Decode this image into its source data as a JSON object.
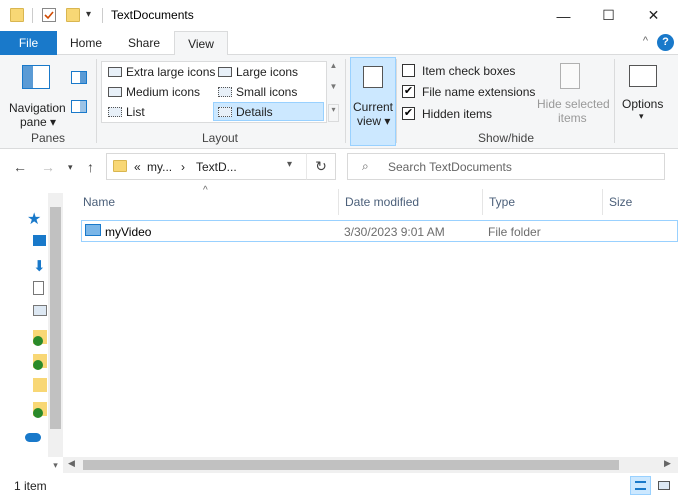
{
  "window": {
    "title": "TextDocuments",
    "minimize": "—",
    "maximize": "☐",
    "close": "✕"
  },
  "ribbon": {
    "tabs": [
      "File",
      "Home",
      "Share",
      "View"
    ],
    "active_tab": "View",
    "collapse": "^",
    "help": "?",
    "panes": {
      "label": "Panes",
      "navigation_pane_line1": "Navigation",
      "navigation_pane_line2": "pane"
    },
    "layout": {
      "label": "Layout",
      "items": [
        "Extra large icons",
        "Large icons",
        "Medium icons",
        "Small icons",
        "List",
        "Details"
      ],
      "selected": "Details"
    },
    "current_view": {
      "line1": "Current",
      "line2": "view"
    },
    "show_hide": {
      "label": "Show/hide",
      "item_check_boxes": "Item check boxes",
      "file_name_extensions": "File name extensions",
      "hidden_items": "Hidden items",
      "item_check_boxes_checked": false,
      "file_name_extensions_checked": true,
      "hidden_items_checked": true,
      "hide_selected_line1": "Hide selected",
      "hide_selected_line2": "items"
    },
    "options": "Options"
  },
  "address": {
    "overflow": "«",
    "crumb1": "my...",
    "sep": "›",
    "crumb2": "TextD...",
    "search_placeholder": "Search TextDocuments"
  },
  "columns": [
    "Name",
    "Date modified",
    "Type",
    "Size"
  ],
  "files": [
    {
      "name": "myVideo",
      "date_modified": "3/30/2023 9:01 AM",
      "type": "File folder",
      "size": ""
    }
  ],
  "status": {
    "item_count": "1 item"
  },
  "colors": {
    "accent": "#1979ca",
    "selection": "#cce8ff",
    "selection_border": "#99d1ff",
    "folder": "#f8d775"
  }
}
